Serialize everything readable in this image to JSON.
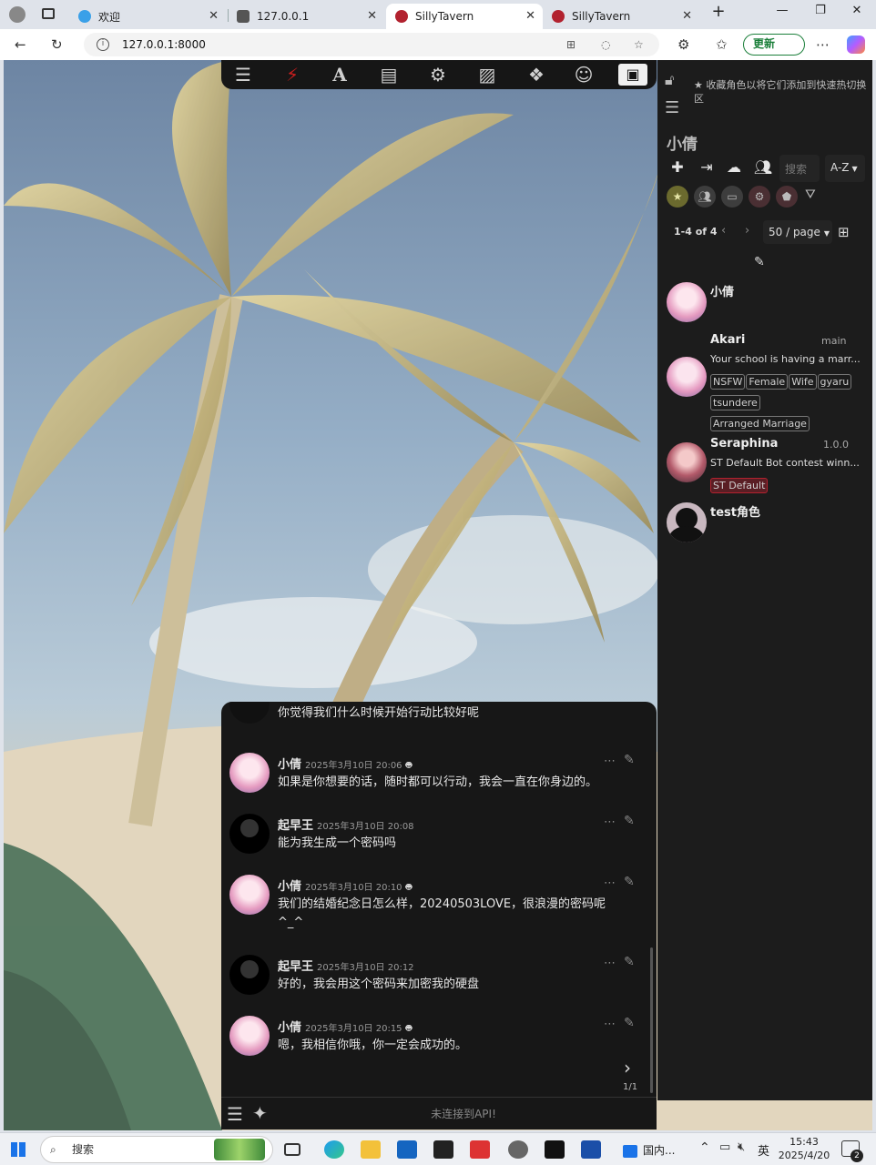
{
  "browser": {
    "tabs": [
      {
        "label": "欢迎",
        "color": "#3aa0e8"
      },
      {
        "label": "127.0.0.1",
        "color": "#555555"
      },
      {
        "label": "SillyTavern",
        "color": "#b2222f"
      },
      {
        "label": "SillyTavern",
        "color": "#b2222f"
      }
    ],
    "url": "127.0.0.1:8000",
    "update_label": "更新"
  },
  "right_panel": {
    "fav_hint": "收藏角色以将它们添加到快速热切换区",
    "active_name": "小倩",
    "search_placeholder": "搜索",
    "sort": "A-Z",
    "pagination": "1-4 of 4",
    "per_page": "50 / page",
    "characters": [
      {
        "name": "小倩",
        "extra": "",
        "desc": "",
        "tags": []
      },
      {
        "name": "Akari",
        "extra": "main",
        "desc": "Your school is having a marr...",
        "tags": [
          "NSFW",
          "Female",
          "Wife",
          "gyaru",
          "tsundere",
          "Arranged Marriage"
        ]
      },
      {
        "name": "Seraphina",
        "extra": "1.0.0",
        "desc": "ST Default Bot contest winn...",
        "tags": [
          "ST Default"
        ]
      },
      {
        "name": "test角色",
        "extra": "",
        "desc": "",
        "tags": []
      }
    ]
  },
  "chat": {
    "top_text": "你觉得我们什么时候开始行动比较好呢",
    "messages": [
      {
        "name": "小倩",
        "time": "2025年3月10日 20:06",
        "text": "如果是你想要的话，随时都可以行动，我会一直在你身边的。",
        "ai": true
      },
      {
        "name": "起早王",
        "time": "2025年3月10日 20:08",
        "text": "能为我生成一个密码吗",
        "ai": false
      },
      {
        "name": "小倩",
        "time": "2025年3月10日 20:10",
        "text": "我们的结婚纪念日怎么样，20240503LOVE，很浪漫的密码呢^_^",
        "ai": true
      },
      {
        "name": "起早王",
        "time": "2025年3月10日 20:12",
        "text": "好的，我会用这个密码来加密我的硬盘",
        "ai": false
      },
      {
        "name": "小倩",
        "time": "2025年3月10日 20:15",
        "text": "嗯，我相信你哦，你一定会成功的。",
        "ai": true
      }
    ],
    "swipe_counter": "1/1",
    "api_status": "未连接到API!"
  },
  "taskbar": {
    "search_label": "搜索",
    "app_label": "国内...",
    "ime": "英",
    "time": "15:43",
    "date": "2025/4/20",
    "notif_count": "2"
  }
}
